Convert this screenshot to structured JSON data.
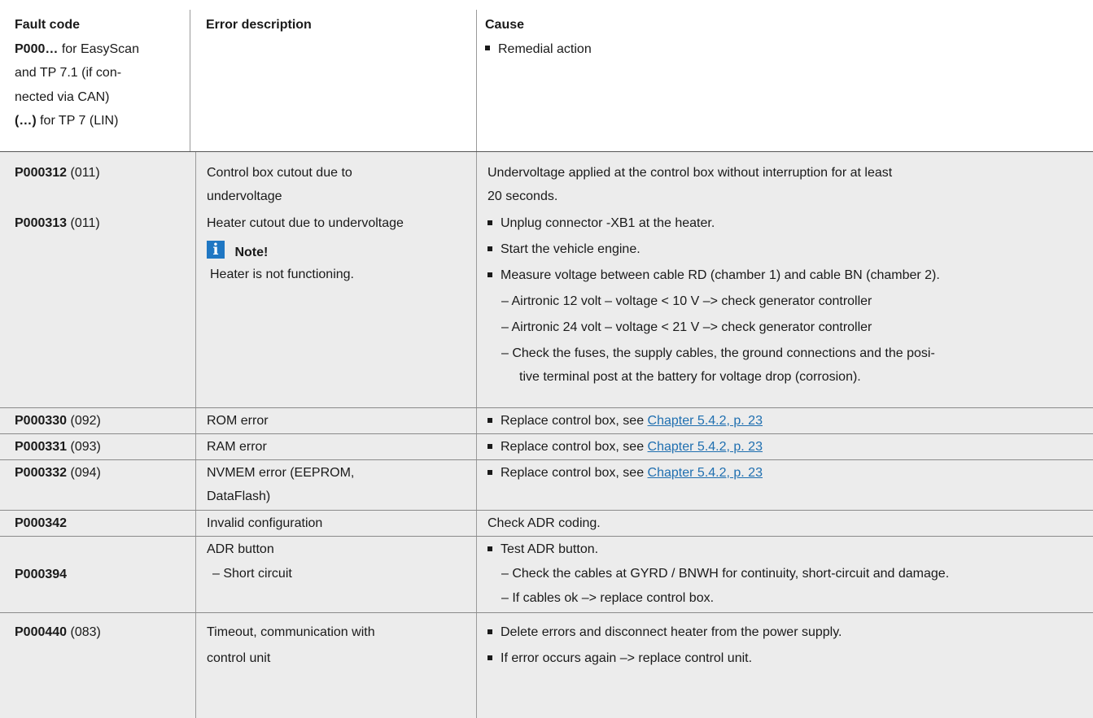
{
  "header": {
    "col1": {
      "title": "Fault code",
      "line2_bold": "P000…",
      "line2_text": " for EasyScan",
      "line3": "and TP 7.1 (if con-",
      "line4": "nected via CAN)",
      "line5_bold": "(…)",
      "line5_text": " for TP 7 (LIN)"
    },
    "col2": {
      "title": "Error description"
    },
    "col3": {
      "title": "Cause",
      "bullet": "Remedial action"
    }
  },
  "rows": [
    {
      "codes": [
        {
          "code": "P000312",
          "sub": " (011)"
        },
        {
          "code": "P000313",
          "sub": " (011)"
        }
      ],
      "desc": {
        "line1": "Control box cutout due to",
        "line2": "undervoltage",
        "line3": "Heater cutout due to undervoltage",
        "note_title": "Note!",
        "note_text": "Heater is not functioning.",
        "note_icon": "info-icon"
      },
      "cause": {
        "line1": "Undervoltage applied at the control box without interruption for at least",
        "line2": "20 seconds.",
        "b1": "Unplug connector -XB1 at the heater.",
        "b2": "Start the vehicle engine.",
        "b3": "Measure voltage between cable RD (chamber 1) and cable BN (chamber 2).",
        "d1": "–  Airtronic 12 volt – voltage < 10 V –> check generator controller",
        "d2": "–  Airtronic 24 volt – voltage < 21 V –> check generator controller",
        "d3a": "–  Check the fuses, the supply cables, the ground connections and the posi-",
        "d3b": "tive terminal post at the battery for voltage drop (corrosion)."
      }
    },
    {
      "code": "P000330",
      "sub": " (092)",
      "desc": "ROM error",
      "cause_text": "Replace control box, see ",
      "link": "Chapter 5.4.2, p. 23"
    },
    {
      "code": "P000331",
      "sub": " (093)",
      "desc": "RAM error",
      "cause_text": "Replace control box, see ",
      "link": "Chapter 5.4.2, p. 23"
    },
    {
      "code": "P000332",
      "sub": " (094)",
      "desc1": "NVMEM error (EEPROM,",
      "desc2": "DataFlash)",
      "cause_text": "Replace control box, see ",
      "link": "Chapter 5.4.2, p. 23"
    },
    {
      "code": "P000342",
      "desc": "Invalid configuration",
      "cause_text": "Check ADR coding."
    },
    {
      "code": "P000394",
      "desc1": "ADR button",
      "desc2": "–  Short circuit",
      "b1": "Test ADR button.",
      "d1": "–  Check the cables at GYRD / BNWH for continuity, short-circuit and damage.",
      "d2": "–  If cables ok –> replace control box."
    },
    {
      "code": "P000440",
      "sub": " (083)",
      "desc1": "Timeout, communication with",
      "desc2": "control unit",
      "b1": "Delete errors and disconnect heater from the power supply.",
      "b2": "If error occurs again –> replace control unit."
    }
  ]
}
